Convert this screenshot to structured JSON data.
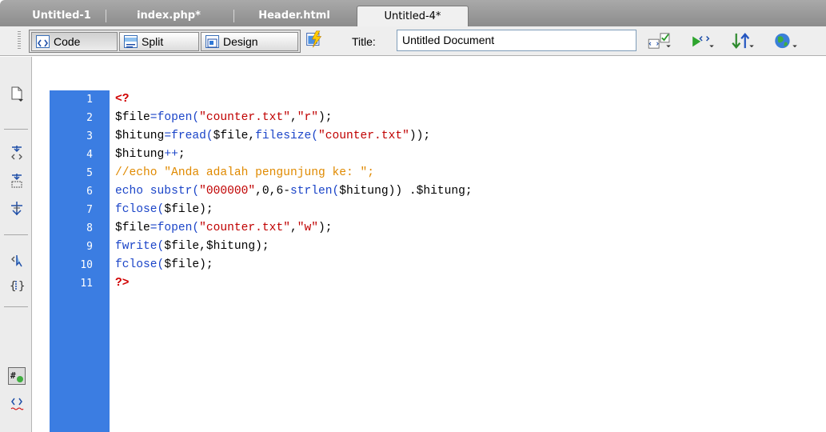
{
  "tabs": [
    {
      "label": "Untitled-1",
      "active": false
    },
    {
      "label": "index.php*",
      "active": false
    },
    {
      "label": "Header.html",
      "active": false
    },
    {
      "label": "Untitled-4*",
      "active": true
    }
  ],
  "toolbar": {
    "code_label": "Code",
    "split_label": "Split",
    "design_label": "Design",
    "title_label": "Title:",
    "title_value": "Untitled Document",
    "active_view": "Code"
  },
  "editor": {
    "line_numbers": [
      "1",
      "2",
      "3",
      "4",
      "5",
      "6",
      "7",
      "8",
      "9",
      "10",
      "11"
    ],
    "lines": [
      [
        {
          "t": "<?",
          "c": "tag"
        }
      ],
      [
        {
          "t": "$file",
          "c": "var"
        },
        {
          "t": "=",
          "c": "op"
        },
        {
          "t": "fopen(",
          "c": "fn"
        },
        {
          "t": "\"counter.txt\"",
          "c": "str"
        },
        {
          "t": ",",
          "c": "var"
        },
        {
          "t": "\"r\"",
          "c": "str"
        },
        {
          "t": ");",
          "c": "var"
        }
      ],
      [
        {
          "t": "$hitung",
          "c": "var"
        },
        {
          "t": "=",
          "c": "op"
        },
        {
          "t": "fread(",
          "c": "fn"
        },
        {
          "t": "$file,",
          "c": "var"
        },
        {
          "t": "filesize(",
          "c": "fn"
        },
        {
          "t": "\"counter.txt\"",
          "c": "str"
        },
        {
          "t": "));",
          "c": "var"
        }
      ],
      [
        {
          "t": "$hitung",
          "c": "var"
        },
        {
          "t": "++",
          "c": "op"
        },
        {
          "t": ";",
          "c": "var"
        }
      ],
      [
        {
          "t": "//echo \"Anda adalah pengunjung ke: \";",
          "c": "cmt"
        }
      ],
      [
        {
          "t": "echo ",
          "c": "fn"
        },
        {
          "t": "substr(",
          "c": "fn"
        },
        {
          "t": "\"000000\"",
          "c": "str"
        },
        {
          "t": ",0,6-",
          "c": "var"
        },
        {
          "t": "strlen(",
          "c": "fn"
        },
        {
          "t": "$hitung)) .$hitung;",
          "c": "var"
        }
      ],
      [
        {
          "t": "fclose(",
          "c": "fn"
        },
        {
          "t": "$file);",
          "c": "var"
        }
      ],
      [
        {
          "t": "$file",
          "c": "var"
        },
        {
          "t": "=",
          "c": "op"
        },
        {
          "t": "fopen(",
          "c": "fn"
        },
        {
          "t": "\"counter.txt\"",
          "c": "str"
        },
        {
          "t": ",",
          "c": "var"
        },
        {
          "t": "\"w\"",
          "c": "str"
        },
        {
          "t": ");",
          "c": "var"
        }
      ],
      [
        {
          "t": "fwrite(",
          "c": "fn"
        },
        {
          "t": "$file,$hitung);",
          "c": "var"
        }
      ],
      [
        {
          "t": "fclose(",
          "c": "fn"
        },
        {
          "t": "$file);",
          "c": "var"
        }
      ],
      [
        {
          "t": "?>",
          "c": "tag"
        }
      ]
    ]
  },
  "colors": {
    "gutter": "#3b7de2",
    "tag": "#d00000",
    "function": "#1a44c8",
    "string": "#c00000",
    "comment": "#e08a00"
  },
  "icons": {
    "rail": [
      "open-documents-icon",
      "collapse-full-tag-icon",
      "collapse-selection-icon",
      "expand-all-icon",
      "select-parent-tag-icon",
      "balance-braces-icon",
      "line-numbers-icon",
      "syntax-error-icon"
    ],
    "toolbar": [
      "live-view-icon",
      "validate-markup-icon",
      "check-browser-compat-icon",
      "file-transfer-icon",
      "preview-browser-icon"
    ]
  }
}
